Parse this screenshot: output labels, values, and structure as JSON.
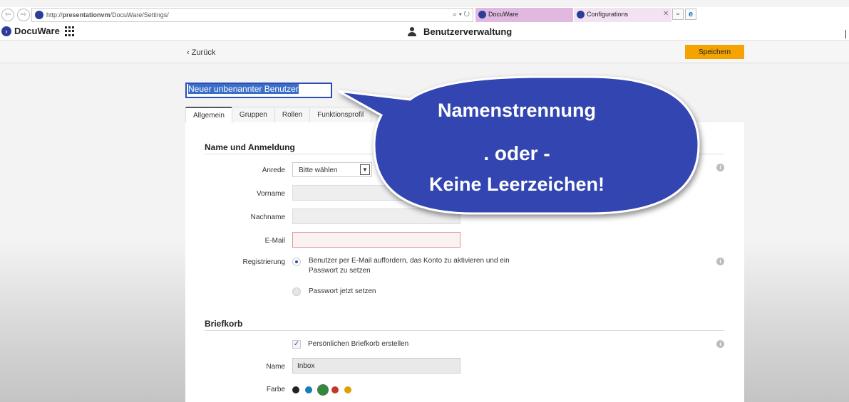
{
  "browser": {
    "url_prefix": "http://",
    "url_host": "presentationvm",
    "url_path": "/DocuWare/Settings/",
    "tabs": [
      {
        "label": "DocuWare",
        "color": "#e0b8e0"
      },
      {
        "label": "Configurations",
        "color": "#f2e2f2"
      }
    ]
  },
  "app": {
    "logo_text": "DocuWare",
    "title": "Benutzerverwaltung"
  },
  "toolbar": {
    "back_label": "‹ Zurück",
    "save_label": "Speichern",
    "save_color": "#f5a300"
  },
  "user": {
    "name_value": "Neuer unbenannter Benutzer"
  },
  "tabs": [
    "Allgemein",
    "Gruppen",
    "Rollen",
    "Funktionsprofil"
  ],
  "active_tab": "Allgemein",
  "sections": {
    "name_login": {
      "title": "Name und Anmeldung",
      "anrede_label": "Anrede",
      "anrede_value": "Bitte wählen",
      "vorname_label": "Vorname",
      "nachname_label": "Nachname",
      "email_label": "E-Mail",
      "registrierung_label": "Registrierung",
      "option_email": "Benutzer per E-Mail auffordern, das Konto zu aktivieren und ein Passwort zu setzen",
      "option_password": "Passwort jetzt setzen",
      "selected_option": "option_email"
    },
    "briefkorb": {
      "title": "Briefkorb",
      "checkbox_label": "Persönlichen Briefkorb erstellen",
      "checkbox_checked": true,
      "name_label": "Name",
      "name_value": "Inbox",
      "farbe_label": "Farbe",
      "colors": [
        "#222222",
        "#1a7bbf",
        "#2e8b3a",
        "#c0392b",
        "#e0a000"
      ],
      "selected_color": "#2e8b3a"
    }
  },
  "annotation": {
    "line1": "Namenstrennung",
    "line2": ". oder -",
    "line3": "Keine Leerzeichen!",
    "bubble_color": "#3145b0"
  },
  "icons": {
    "back": "arrow-left-icon",
    "forward": "arrow-right-icon",
    "search": "search-icon",
    "refresh": "refresh-icon",
    "apps": "grid-icon",
    "user": "user-icon",
    "info": "info-icon",
    "check": "check-icon",
    "dropdown": "chevron-down-icon"
  }
}
